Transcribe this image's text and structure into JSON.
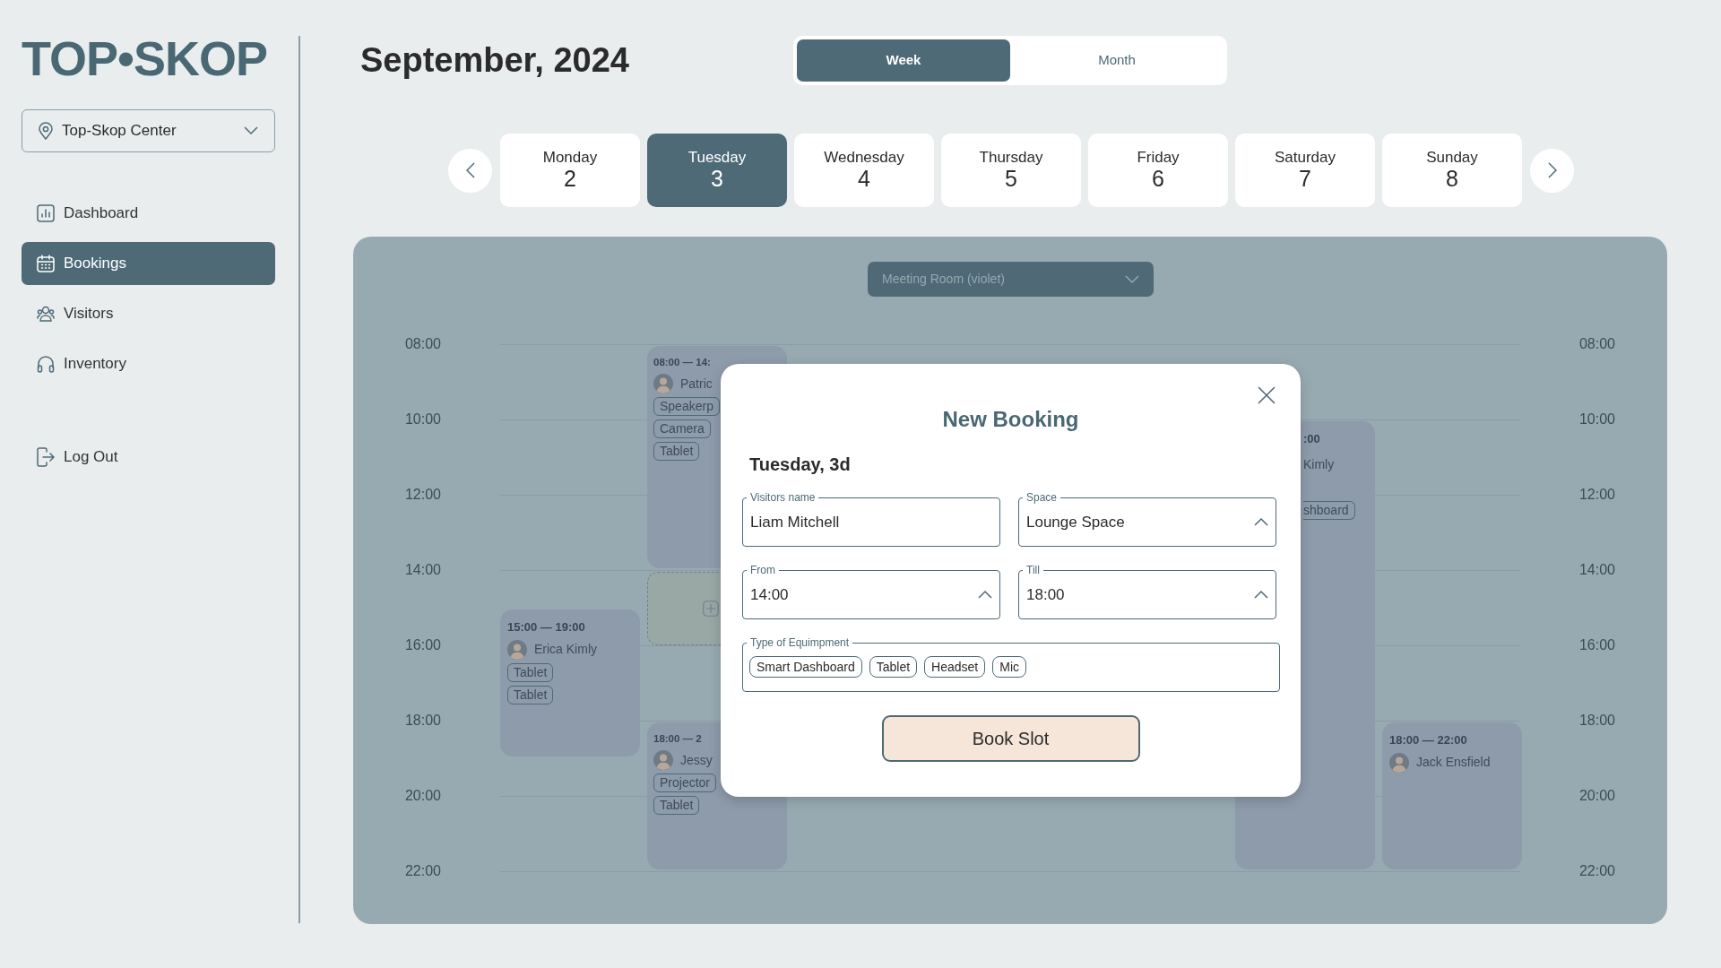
{
  "logo": "TOP•SKOP",
  "location": {
    "value": "Top-Skop Center"
  },
  "nav": [
    {
      "label": "Dashboard",
      "selected": false
    },
    {
      "label": "Bookings",
      "selected": true
    },
    {
      "label": "Visitors",
      "selected": false
    },
    {
      "label": "Inventory",
      "selected": false
    }
  ],
  "logout": {
    "label": "Log Out"
  },
  "header": {
    "title": "September, 2024"
  },
  "view_toggle": [
    {
      "label": "Week",
      "selected": true
    },
    {
      "label": "Month",
      "selected": false
    }
  ],
  "days": [
    {
      "name": "Monday",
      "date": "2",
      "selected": false
    },
    {
      "name": "Tuesday",
      "date": "3",
      "selected": true
    },
    {
      "name": "Wednesday",
      "date": "4",
      "selected": false
    },
    {
      "name": "Thursday",
      "date": "5",
      "selected": false
    },
    {
      "name": "Friday",
      "date": "6",
      "selected": false
    },
    {
      "name": "Saturday",
      "date": "7",
      "selected": false
    },
    {
      "name": "Sunday",
      "date": "8",
      "selected": false
    }
  ],
  "calendar": {
    "room_select": {
      "value": "Meeting Room (violet)"
    },
    "hours_left": [
      "08:00",
      "10:00",
      "12:00",
      "14:00",
      "16:00",
      "18:00",
      "20:00",
      "22:00"
    ],
    "hours_right": [
      "08:00",
      "10:00",
      "12:00",
      "14:00",
      "16:00",
      "18:00",
      "20:00",
      "22:00"
    ],
    "events": [
      {
        "time": "08:00 — 14:",
        "visitor": "Patric",
        "avatar": true,
        "tags": [
          "Speakerp",
          "Camera",
          "Tablet"
        ]
      },
      {
        "time": "15:00 — 19:00",
        "visitor": "Erica Kimly",
        "avatar": true,
        "tags": [
          "Tablet",
          "Tablet"
        ]
      },
      {
        "time": "18:00 — 2",
        "visitor": "Jessy",
        "avatar": true,
        "tags": [
          "Projector",
          "Tablet"
        ]
      },
      {
        "time": ":00",
        "visitor": "Kimly",
        "avatar": false,
        "tags": [
          "shboard"
        ]
      },
      {
        "time": "18:00 — 22:00",
        "visitor": "Jack Ensfield",
        "avatar": true
      }
    ]
  },
  "modal": {
    "title": "New Booking",
    "date": "Tuesday, 3d",
    "fields": [
      {
        "kind": "text",
        "label": "Visitors name",
        "value": "Liam Mitchell"
      },
      {
        "kind": "select",
        "label": "Space",
        "value": "Lounge Space"
      },
      {
        "kind": "select",
        "label": "From",
        "value": "14:00"
      },
      {
        "kind": "select",
        "label": "Till",
        "value": "18:00"
      }
    ],
    "equipment": {
      "label": "Type of Equimpment",
      "tags": [
        "Smart Dashboard",
        "Tablet",
        "Headset",
        "Mic"
      ]
    },
    "submit": "Book Slot"
  }
}
